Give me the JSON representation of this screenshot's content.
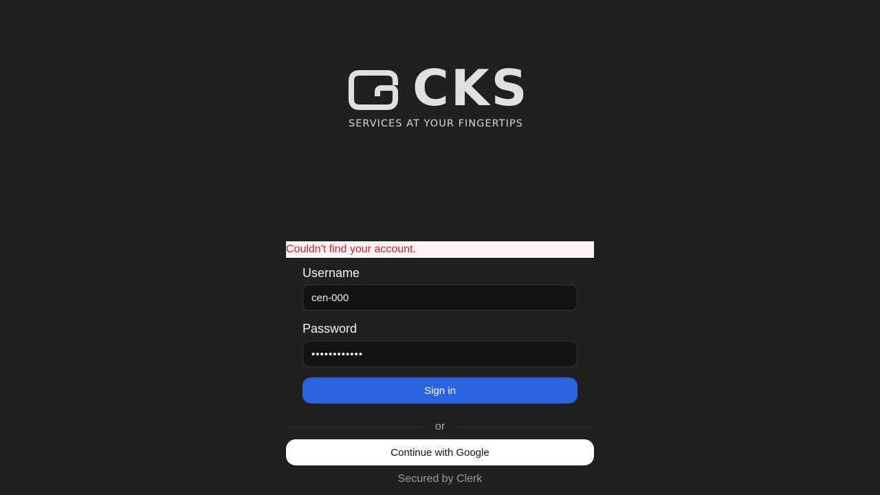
{
  "brand": {
    "name": "CKS",
    "tagline": "SERVICES AT YOUR FINGERTIPS",
    "logo_icon": "cks-logo-icon"
  },
  "signin": {
    "error_message": "Couldn't find your account.",
    "username_label": "Username",
    "username_value": "cen-000",
    "password_label": "Password",
    "password_value": "cenpassword1",
    "submit_label": "Sign in",
    "divider_text": "or",
    "google_label": "Continue with Google",
    "footer_text": "Secured by Clerk"
  },
  "colors": {
    "background": "#202020",
    "primary": "#2c62e0",
    "error_text": "#c8262d",
    "error_bg": "#fff2f2"
  }
}
